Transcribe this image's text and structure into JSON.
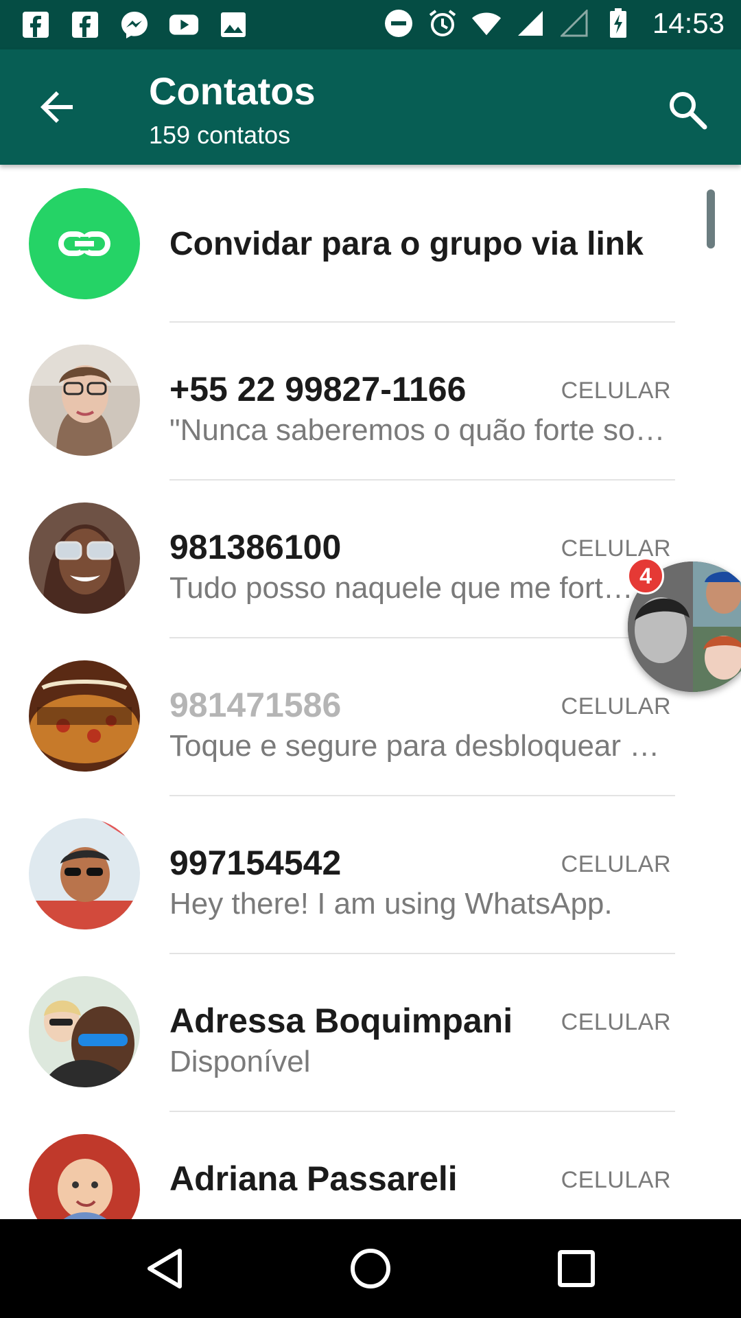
{
  "status_bar": {
    "time": "14:53",
    "left_icons": [
      "facebook-icon",
      "facebook-icon",
      "messenger-icon",
      "youtube-icon",
      "gallery-icon"
    ],
    "right_icons": [
      "dnd-icon",
      "alarm-icon",
      "wifi-icon",
      "signal-icon",
      "signal-empty-icon",
      "battery-charging-icon"
    ]
  },
  "app_bar": {
    "title": "Contatos",
    "subtitle": "159 contatos",
    "back_icon": "arrow-back-icon",
    "search_icon": "search-icon"
  },
  "invite": {
    "label": "Convidar para o grupo via link",
    "icon": "link-icon",
    "color": "#25d366"
  },
  "contacts": [
    {
      "name": "+55 22 99827-1166",
      "type": "CELULAR",
      "status": "\"Nunca saberemos o quão forte somos até que ser forte seja a única opção\"",
      "disabled": false
    },
    {
      "name": "981386100",
      "type": "CELULAR",
      "status": "Tudo posso naquele que me fortalece",
      "disabled": false
    },
    {
      "name": "981471586",
      "type": "CELULAR",
      "status": "Toque e segure para desbloquear este contato",
      "disabled": true
    },
    {
      "name": "997154542",
      "type": "CELULAR",
      "status": "Hey there! I am using WhatsApp.",
      "disabled": false
    },
    {
      "name": "Adressa Boquimpani",
      "type": "CELULAR",
      "status": "Disponível",
      "disabled": false
    },
    {
      "name": "Adriana Passareli",
      "type": "CELULAR",
      "status": "",
      "disabled": false
    }
  ],
  "chat_head": {
    "badge_count": "4"
  },
  "colors": {
    "status_bar": "#054d44",
    "app_bar": "#075e54",
    "accent": "#25d366",
    "badge": "#e53935"
  },
  "nav_bar": {
    "back_icon": "nav-back-icon",
    "home_icon": "nav-home-icon",
    "recents_icon": "nav-recents-icon"
  }
}
